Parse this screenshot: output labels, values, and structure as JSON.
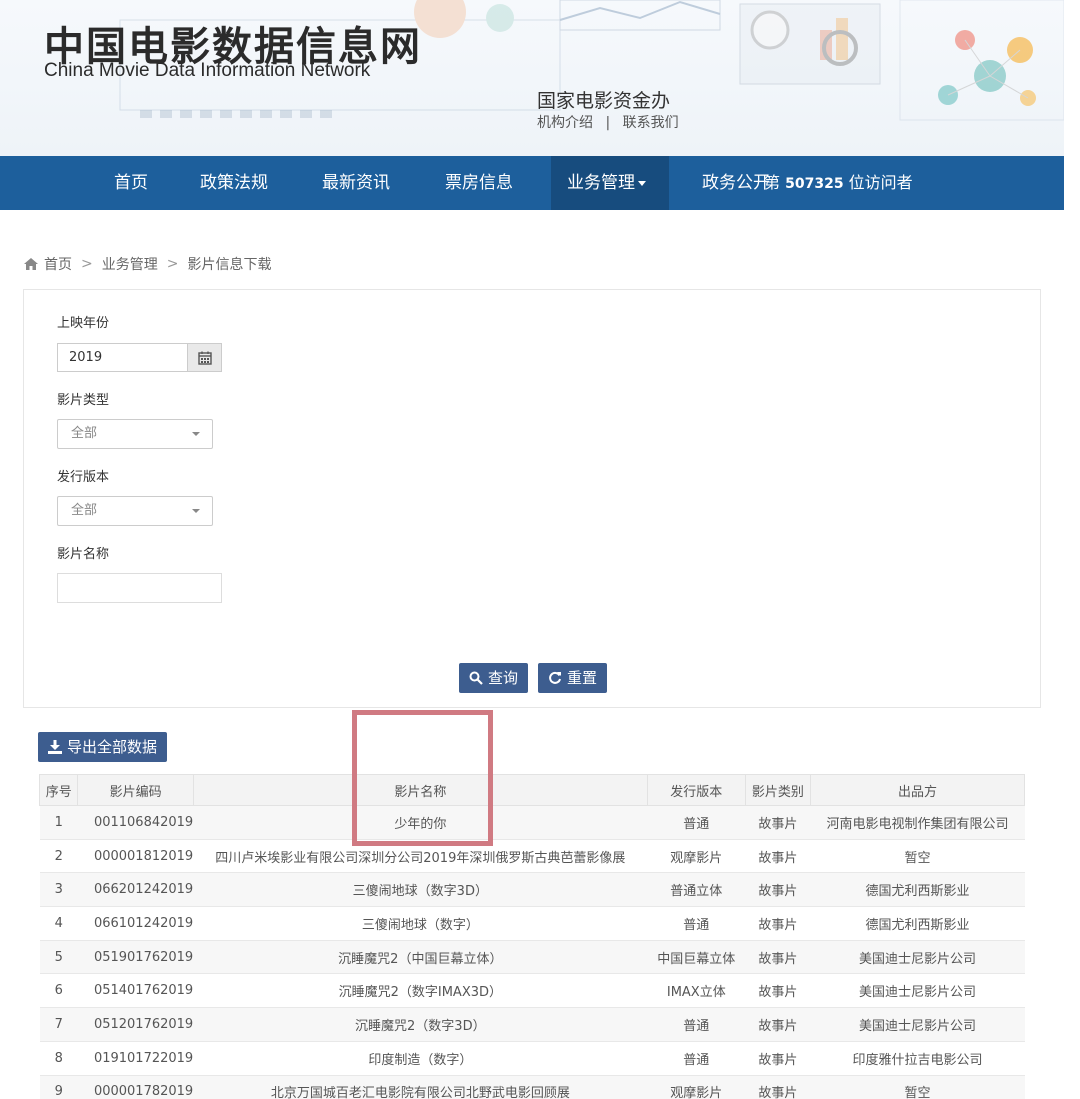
{
  "header": {
    "logo_cn": "中国电影数据信息网",
    "logo_en": "China Movie Data Information Network",
    "org_name": "国家电影资金办",
    "org_links": [
      "机构介绍",
      "联系我们"
    ],
    "org_sep": "|"
  },
  "nav": {
    "items": [
      "首页",
      "政策法规",
      "最新资讯",
      "票房信息",
      "业务管理",
      "政务公开"
    ],
    "active_index": 4,
    "visitors_prefix": "第",
    "visitors_count": "507325",
    "visitors_suffix": "位访问者"
  },
  "breadcrumb": {
    "items": [
      "首页",
      "业务管理",
      "影片信息下载"
    ],
    "sep": ">"
  },
  "filters": {
    "year_label": "上映年份",
    "year_value": "2019",
    "type_label": "影片类型",
    "type_value": "全部",
    "version_label": "发行版本",
    "version_value": "全部",
    "name_label": "影片名称",
    "name_value": "",
    "query_button": "查询",
    "reset_button": "重置"
  },
  "export_button": "导出全部数据",
  "table": {
    "headers": [
      "序号",
      "影片编码",
      "影片名称",
      "发行版本",
      "影片类别",
      "出品方"
    ],
    "rows": [
      [
        "1",
        "001106842019",
        "少年的你",
        "普通",
        "故事片",
        "河南电影电视制作集团有限公司"
      ],
      [
        "2",
        "000001812019",
        "四川卢米埃影业有限公司深圳分公司2019年深圳俄罗斯古典芭蕾影像展",
        "观摩影片",
        "故事片",
        "暂空"
      ],
      [
        "3",
        "066201242019",
        "三傻闹地球（数字3D）",
        "普通立体",
        "故事片",
        "德国尤利西斯影业"
      ],
      [
        "4",
        "066101242019",
        "三傻闹地球（数字）",
        "普通",
        "故事片",
        "德国尤利西斯影业"
      ],
      [
        "5",
        "051901762019",
        "沉睡魔咒2（中国巨幕立体）",
        "中国巨幕立体",
        "故事片",
        "美国迪士尼影片公司"
      ],
      [
        "6",
        "051401762019",
        "沉睡魔咒2（数字IMAX3D）",
        "IMAX立体",
        "故事片",
        "美国迪士尼影片公司"
      ],
      [
        "7",
        "051201762019",
        "沉睡魔咒2（数字3D）",
        "普通",
        "故事片",
        "美国迪士尼影片公司"
      ],
      [
        "8",
        "019101722019",
        "印度制造（数字）",
        "普通",
        "故事片",
        "印度雅什拉吉电影公司"
      ],
      [
        "9",
        "000001782019",
        "北京万国城百老汇电影院有限公司北野武电影回顾展",
        "观摩影片",
        "故事片",
        "暂空"
      ]
    ]
  },
  "colors": {
    "nav_bg": "#1d5f9c",
    "nav_active": "#174c7e",
    "button": "#3d5d8f",
    "highlight": "#d07a82"
  }
}
